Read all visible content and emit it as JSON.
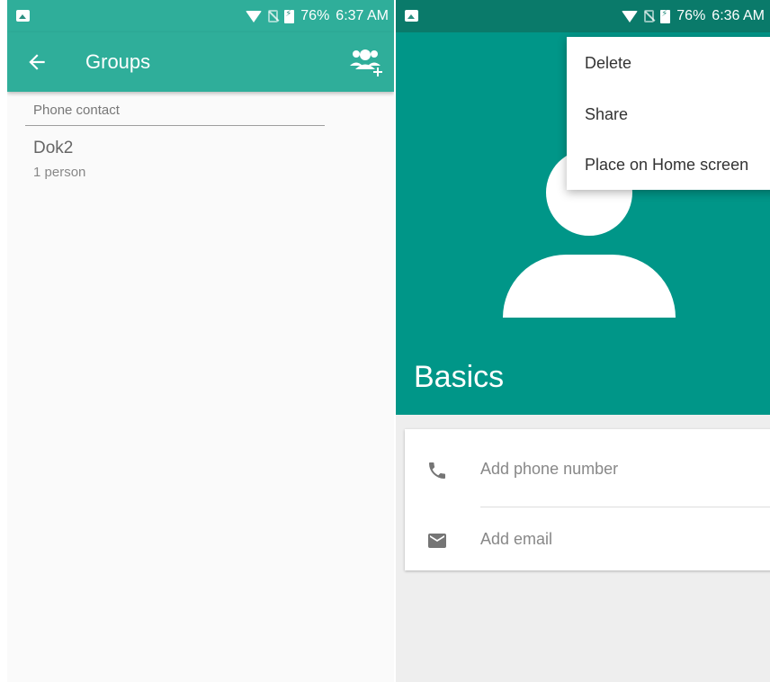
{
  "left": {
    "status": {
      "battery": "76%",
      "time": "6:37 AM"
    },
    "app_bar": {
      "title": "Groups"
    },
    "section_header": "Phone contact",
    "groups": [
      {
        "name": "Dok2",
        "count": "1 person"
      }
    ]
  },
  "right": {
    "status": {
      "battery": "76%",
      "time": "6:36 AM"
    },
    "header_title": "Basics",
    "fields": {
      "phone_placeholder": "Add phone number",
      "email_placeholder": "Add email"
    },
    "menu": [
      "Delete",
      "Share",
      "Place on Home screen"
    ]
  },
  "icons": [
    "gallery-icon",
    "wifi-icon",
    "no-sim-icon",
    "battery-icon",
    "back-arrow-icon",
    "add-group-icon",
    "phone-icon",
    "email-icon"
  ],
  "colors": {
    "left_primary": "#2fae9a",
    "right_primary": "#009688",
    "right_status": "#0a7a6a"
  }
}
